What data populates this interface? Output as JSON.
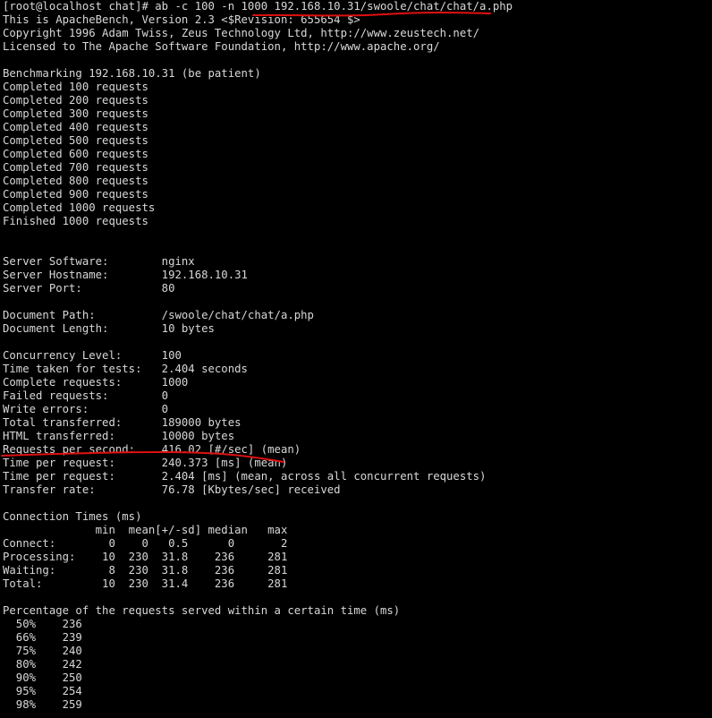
{
  "terminal": {
    "command_line": "[root@localhost chat]# ab -c 100 -n 1000 192.168.10.31/swoole/chat/chat/a.php",
    "header": [
      "This is ApacheBench, Version 2.3 <$Revision: 655654 $>",
      "Copyright 1996 Adam Twiss, Zeus Technology Ltd, http://www.zeustech.net/",
      "Licensed to The Apache Software Foundation, http://www.apache.org/"
    ],
    "benchmarking": "Benchmarking 192.168.10.31 (be patient)",
    "progress": [
      "Completed 100 requests",
      "Completed 200 requests",
      "Completed 300 requests",
      "Completed 400 requests",
      "Completed 500 requests",
      "Completed 600 requests",
      "Completed 700 requests",
      "Completed 800 requests",
      "Completed 900 requests",
      "Completed 1000 requests",
      "Finished 1000 requests"
    ],
    "server": [
      "Server Software:        nginx",
      "Server Hostname:        192.168.10.31",
      "Server Port:            80"
    ],
    "document": [
      "Document Path:          /swoole/chat/chat/a.php",
      "Document Length:        10 bytes"
    ],
    "stats": [
      "Concurrency Level:      100",
      "Time taken for tests:   2.404 seconds",
      "Complete requests:      1000",
      "Failed requests:        0",
      "Write errors:           0",
      "Total transferred:      189000 bytes",
      "HTML transferred:       10000 bytes",
      "Requests per second:    416.02 [#/sec] (mean)",
      "Time per request:       240.373 [ms] (mean)",
      "Time per request:       2.404 [ms] (mean, across all concurrent requests)",
      "Transfer rate:          76.78 [Kbytes/sec] received"
    ],
    "connection_times": [
      "Connection Times (ms)",
      "              min  mean[+/-sd] median   max",
      "Connect:        0    0   0.5      0       2",
      "Processing:    10  230  31.8    236     281",
      "Waiting:        8  230  31.8    236     281",
      "Total:         10  230  31.4    236     281"
    ],
    "percentiles": [
      "Percentage of the requests served within a certain time (ms)",
      "  50%    236",
      "  66%    239",
      "  75%    240",
      "  80%    242",
      "  90%    250",
      "  95%    254",
      "  98%    259"
    ]
  },
  "colors": {
    "background": "#000000",
    "text": "#d8d8d8",
    "annotation": "#e01010"
  }
}
